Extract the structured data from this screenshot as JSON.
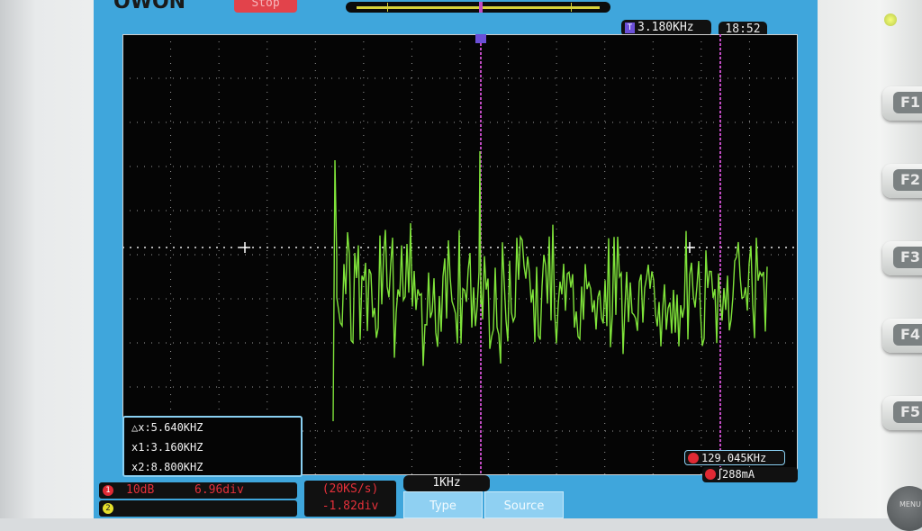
{
  "header": {
    "brand": "OWON",
    "run_state": "Stop",
    "trigger_frequency": "3.180KHz",
    "time": "18:52"
  },
  "cursors": {
    "delta": "△x:5.640KHZ",
    "x1": "x1:3.160KHZ",
    "x2": "x2:8.800KHZ"
  },
  "readouts": {
    "frequency": "129.045KHz",
    "trigger_level": "288mA"
  },
  "channels": {
    "ch1": {
      "number": "1",
      "scale": "10dB",
      "position": "6.96div"
    },
    "ch2": {
      "number": "2"
    }
  },
  "acquisition": {
    "sample_rate": "(20KS/s)",
    "offset": "-1.82div",
    "span": "1KHz"
  },
  "menu": {
    "type_label": "Type",
    "source_label": "Source"
  },
  "side_keys": [
    "F1",
    "F2",
    "F3",
    "F4",
    "F5"
  ],
  "knob_label": "MENU",
  "trigger_marker": "T",
  "colors": {
    "trace": "#7fe33a",
    "screen_frame": "#3fa6dc",
    "cursor_line": "#c04ac2",
    "channel1": "#e5303a",
    "channel2": "#e6df2c"
  }
}
